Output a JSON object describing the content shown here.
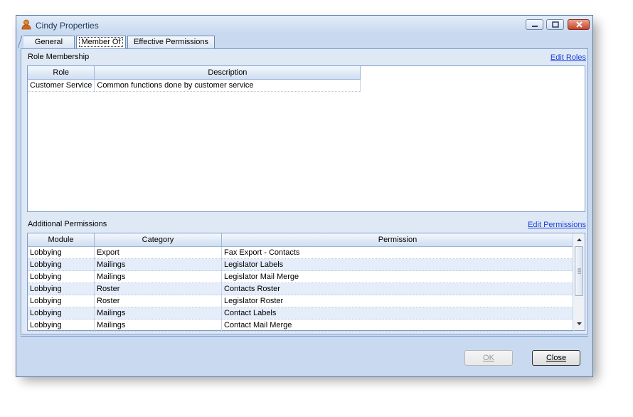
{
  "window": {
    "title": "Cindy Properties"
  },
  "tabs": [
    {
      "label": "General"
    },
    {
      "label": "Member Of"
    },
    {
      "label": "Effective Permissions"
    }
  ],
  "roles": {
    "section_label": "Role Membership",
    "edit_link": "Edit Roles",
    "columns": [
      "Role",
      "Description"
    ],
    "rows": [
      {
        "role": "Customer Service",
        "description": "Common functions done by customer service"
      }
    ]
  },
  "permissions": {
    "section_label": "Additional Permissions",
    "edit_link": "Edit Permissions",
    "columns": [
      "Module",
      "Category",
      "Permission"
    ],
    "rows": [
      {
        "module": "Lobbying",
        "category": "Export",
        "permission": "Fax Export - Contacts"
      },
      {
        "module": "Lobbying",
        "category": "Mailings",
        "permission": "Legislator Labels"
      },
      {
        "module": "Lobbying",
        "category": "Mailings",
        "permission": "Legislator Mail Merge"
      },
      {
        "module": "Lobbying",
        "category": "Roster",
        "permission": "Contacts Roster"
      },
      {
        "module": "Lobbying",
        "category": "Roster",
        "permission": "Legislator Roster"
      },
      {
        "module": "Lobbying",
        "category": "Mailings",
        "permission": "Contact Labels"
      },
      {
        "module": "Lobbying",
        "category": "Mailings",
        "permission": "Contact Mail Merge"
      }
    ]
  },
  "buttons": {
    "ok": "OK",
    "close": "Close"
  },
  "colors": {
    "link": "#1c3fd8",
    "frame": "#c9daf0",
    "alt_row": "#e4edf9"
  },
  "icons": {
    "title": "user-icon"
  }
}
